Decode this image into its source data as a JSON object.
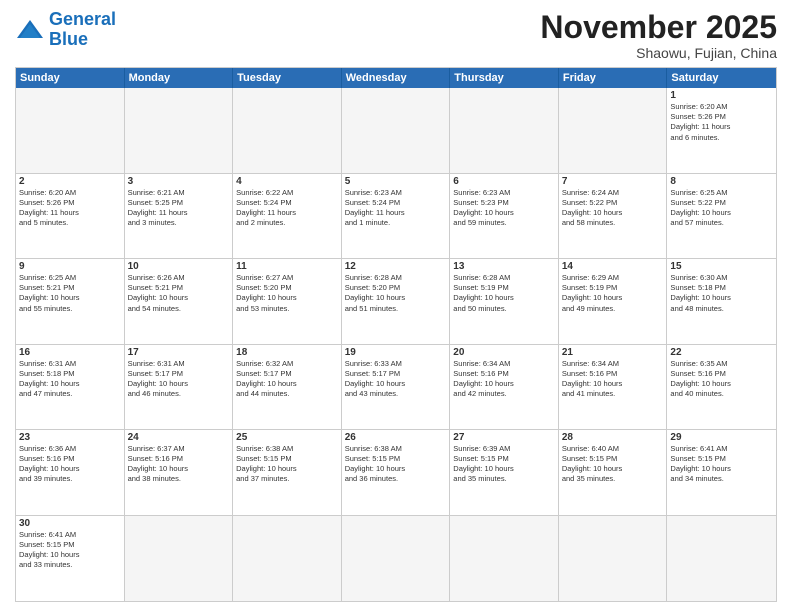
{
  "header": {
    "logo_general": "General",
    "logo_blue": "Blue",
    "month_title": "November 2025",
    "subtitle": "Shaowu, Fujian, China"
  },
  "weekdays": [
    "Sunday",
    "Monday",
    "Tuesday",
    "Wednesday",
    "Thursday",
    "Friday",
    "Saturday"
  ],
  "cells": [
    {
      "date": "",
      "text": "",
      "empty": true
    },
    {
      "date": "",
      "text": "",
      "empty": true
    },
    {
      "date": "",
      "text": "",
      "empty": true
    },
    {
      "date": "",
      "text": "",
      "empty": true
    },
    {
      "date": "",
      "text": "",
      "empty": true
    },
    {
      "date": "",
      "text": "",
      "empty": true
    },
    {
      "date": "1",
      "text": "Sunrise: 6:20 AM\nSunset: 5:26 PM\nDaylight: 11 hours\nand 6 minutes.",
      "empty": false
    },
    {
      "date": "2",
      "text": "Sunrise: 6:20 AM\nSunset: 5:26 PM\nDaylight: 11 hours\nand 5 minutes.",
      "empty": false
    },
    {
      "date": "3",
      "text": "Sunrise: 6:21 AM\nSunset: 5:25 PM\nDaylight: 11 hours\nand 3 minutes.",
      "empty": false
    },
    {
      "date": "4",
      "text": "Sunrise: 6:22 AM\nSunset: 5:24 PM\nDaylight: 11 hours\nand 2 minutes.",
      "empty": false
    },
    {
      "date": "5",
      "text": "Sunrise: 6:23 AM\nSunset: 5:24 PM\nDaylight: 11 hours\nand 1 minute.",
      "empty": false
    },
    {
      "date": "6",
      "text": "Sunrise: 6:23 AM\nSunset: 5:23 PM\nDaylight: 10 hours\nand 59 minutes.",
      "empty": false
    },
    {
      "date": "7",
      "text": "Sunrise: 6:24 AM\nSunset: 5:22 PM\nDaylight: 10 hours\nand 58 minutes.",
      "empty": false
    },
    {
      "date": "8",
      "text": "Sunrise: 6:25 AM\nSunset: 5:22 PM\nDaylight: 10 hours\nand 57 minutes.",
      "empty": false
    },
    {
      "date": "9",
      "text": "Sunrise: 6:25 AM\nSunset: 5:21 PM\nDaylight: 10 hours\nand 55 minutes.",
      "empty": false
    },
    {
      "date": "10",
      "text": "Sunrise: 6:26 AM\nSunset: 5:21 PM\nDaylight: 10 hours\nand 54 minutes.",
      "empty": false
    },
    {
      "date": "11",
      "text": "Sunrise: 6:27 AM\nSunset: 5:20 PM\nDaylight: 10 hours\nand 53 minutes.",
      "empty": false
    },
    {
      "date": "12",
      "text": "Sunrise: 6:28 AM\nSunset: 5:20 PM\nDaylight: 10 hours\nand 51 minutes.",
      "empty": false
    },
    {
      "date": "13",
      "text": "Sunrise: 6:28 AM\nSunset: 5:19 PM\nDaylight: 10 hours\nand 50 minutes.",
      "empty": false
    },
    {
      "date": "14",
      "text": "Sunrise: 6:29 AM\nSunset: 5:19 PM\nDaylight: 10 hours\nand 49 minutes.",
      "empty": false
    },
    {
      "date": "15",
      "text": "Sunrise: 6:30 AM\nSunset: 5:18 PM\nDaylight: 10 hours\nand 48 minutes.",
      "empty": false
    },
    {
      "date": "16",
      "text": "Sunrise: 6:31 AM\nSunset: 5:18 PM\nDaylight: 10 hours\nand 47 minutes.",
      "empty": false
    },
    {
      "date": "17",
      "text": "Sunrise: 6:31 AM\nSunset: 5:17 PM\nDaylight: 10 hours\nand 46 minutes.",
      "empty": false
    },
    {
      "date": "18",
      "text": "Sunrise: 6:32 AM\nSunset: 5:17 PM\nDaylight: 10 hours\nand 44 minutes.",
      "empty": false
    },
    {
      "date": "19",
      "text": "Sunrise: 6:33 AM\nSunset: 5:17 PM\nDaylight: 10 hours\nand 43 minutes.",
      "empty": false
    },
    {
      "date": "20",
      "text": "Sunrise: 6:34 AM\nSunset: 5:16 PM\nDaylight: 10 hours\nand 42 minutes.",
      "empty": false
    },
    {
      "date": "21",
      "text": "Sunrise: 6:34 AM\nSunset: 5:16 PM\nDaylight: 10 hours\nand 41 minutes.",
      "empty": false
    },
    {
      "date": "22",
      "text": "Sunrise: 6:35 AM\nSunset: 5:16 PM\nDaylight: 10 hours\nand 40 minutes.",
      "empty": false
    },
    {
      "date": "23",
      "text": "Sunrise: 6:36 AM\nSunset: 5:16 PM\nDaylight: 10 hours\nand 39 minutes.",
      "empty": false
    },
    {
      "date": "24",
      "text": "Sunrise: 6:37 AM\nSunset: 5:16 PM\nDaylight: 10 hours\nand 38 minutes.",
      "empty": false
    },
    {
      "date": "25",
      "text": "Sunrise: 6:38 AM\nSunset: 5:15 PM\nDaylight: 10 hours\nand 37 minutes.",
      "empty": false
    },
    {
      "date": "26",
      "text": "Sunrise: 6:38 AM\nSunset: 5:15 PM\nDaylight: 10 hours\nand 36 minutes.",
      "empty": false
    },
    {
      "date": "27",
      "text": "Sunrise: 6:39 AM\nSunset: 5:15 PM\nDaylight: 10 hours\nand 35 minutes.",
      "empty": false
    },
    {
      "date": "28",
      "text": "Sunrise: 6:40 AM\nSunset: 5:15 PM\nDaylight: 10 hours\nand 35 minutes.",
      "empty": false
    },
    {
      "date": "29",
      "text": "Sunrise: 6:41 AM\nSunset: 5:15 PM\nDaylight: 10 hours\nand 34 minutes.",
      "empty": false
    },
    {
      "date": "30",
      "text": "Sunrise: 6:41 AM\nSunset: 5:15 PM\nDaylight: 10 hours\nand 33 minutes.",
      "empty": false
    },
    {
      "date": "",
      "text": "",
      "empty": true
    },
    {
      "date": "",
      "text": "",
      "empty": true
    },
    {
      "date": "",
      "text": "",
      "empty": true
    },
    {
      "date": "",
      "text": "",
      "empty": true
    },
    {
      "date": "",
      "text": "",
      "empty": true
    },
    {
      "date": "",
      "text": "",
      "empty": true
    }
  ]
}
